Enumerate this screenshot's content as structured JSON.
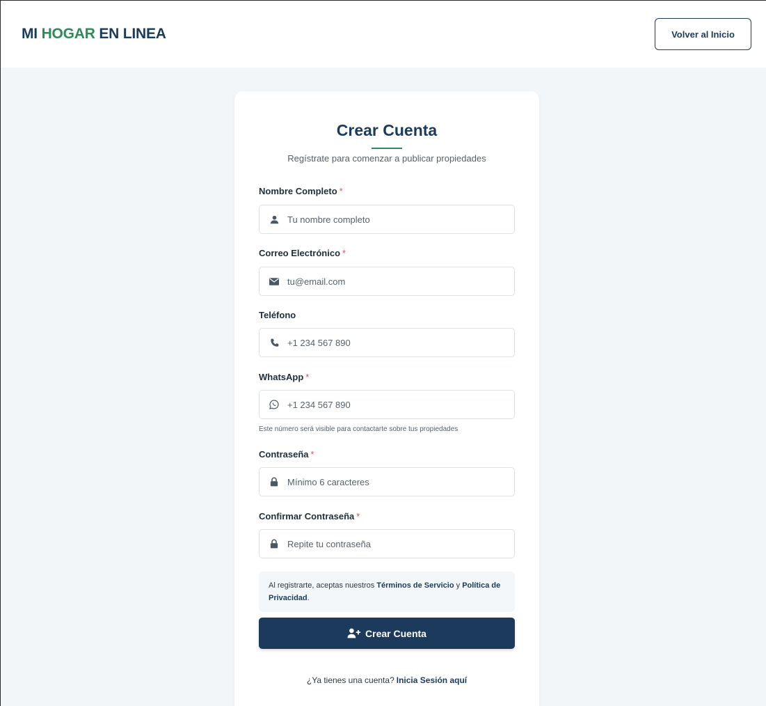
{
  "header": {
    "brand_prefix": "MI ",
    "brand_highlight": "HOGAR",
    "brand_suffix": " EN LINEA",
    "back_label": "Volver al Inicio"
  },
  "form": {
    "title": "Crear Cuenta",
    "subtitle": "Regístrate para comenzar a publicar propiedades",
    "fields": [
      {
        "label": "Nombre Completo",
        "required": "*",
        "placeholder": "Tu nombre completo",
        "icon": "user-icon"
      },
      {
        "label": "Correo Electrónico",
        "required": "*",
        "placeholder": "tu@email.com",
        "icon": "envelope-icon"
      },
      {
        "label": "Teléfono",
        "placeholder": "+1 234 567 890",
        "icon": "phone-icon"
      },
      {
        "label": "WhatsApp",
        "required": "*",
        "placeholder": "+1 234 567 890",
        "icon": "whatsapp-icon",
        "hint": "Este número será visible para contactarte sobre tus propiedades"
      },
      {
        "label": "Contraseña",
        "required": "*",
        "placeholder": "Mínimo 6 caracteres",
        "icon": "lock-icon"
      },
      {
        "label": "Confirmar Contraseña",
        "required": "*",
        "placeholder": "Repite tu contraseña",
        "icon": "lock-icon"
      }
    ],
    "terms": {
      "prefix": "Al registrarte, aceptas nuestros ",
      "tos_link": "Términos de Servicio",
      "middle": " y ",
      "privacy_link": "Política de Privacidad",
      "suffix": "."
    },
    "submit_label": "Crear Cuenta",
    "login_prompt": "¿Ya tienes una cuenta?",
    "login_link": "Inicia Sesión aquí"
  },
  "colors": {
    "primary": "#1b3a5c",
    "accent": "#2e8b57",
    "required": "#e05252"
  }
}
